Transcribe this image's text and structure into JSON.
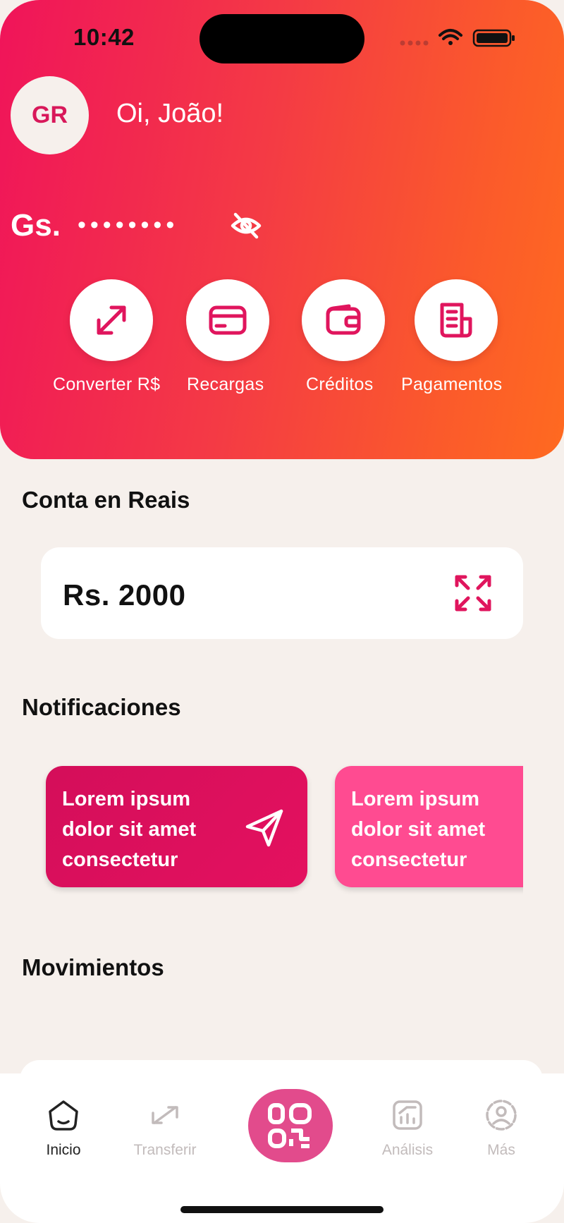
{
  "status_bar": {
    "time": "10:42"
  },
  "header": {
    "avatar_initials": "GR",
    "greeting": "Oi, João!",
    "balance_currency": "Gs.",
    "balance_hidden": "••••••••"
  },
  "quick_actions": [
    {
      "label": "Converter R$",
      "icon": "convert-arrows-icon"
    },
    {
      "label": "Recargas",
      "icon": "card-icon"
    },
    {
      "label": "Créditos",
      "icon": "wallet-icon"
    },
    {
      "label": "Pagamentos",
      "icon": "receipt-icon"
    }
  ],
  "reais_section": {
    "title": "Conta en Reais",
    "value": "Rs. 2000"
  },
  "notifications": {
    "title": "Notificaciones",
    "items": [
      {
        "text": "Lorem ipsum dolor sit amet consectetur",
        "color": "#d90f5b"
      },
      {
        "text": "Lorem ipsum dolor sit amet consectetur",
        "color": "#ff4b91"
      }
    ]
  },
  "movements": {
    "title": "Movimientos"
  },
  "tabbar": {
    "tabs": [
      {
        "label": "Inicio",
        "active": true
      },
      {
        "label": "Transferir",
        "active": false
      },
      {
        "label": "Análisis",
        "active": false
      },
      {
        "label": "Más",
        "active": false
      }
    ]
  },
  "colors": {
    "brand": "#e0155d",
    "gradient_start": "#f0145a",
    "gradient_end": "#ff6a20",
    "background": "#f6f0ec",
    "qr_button": "#e24b8c"
  }
}
